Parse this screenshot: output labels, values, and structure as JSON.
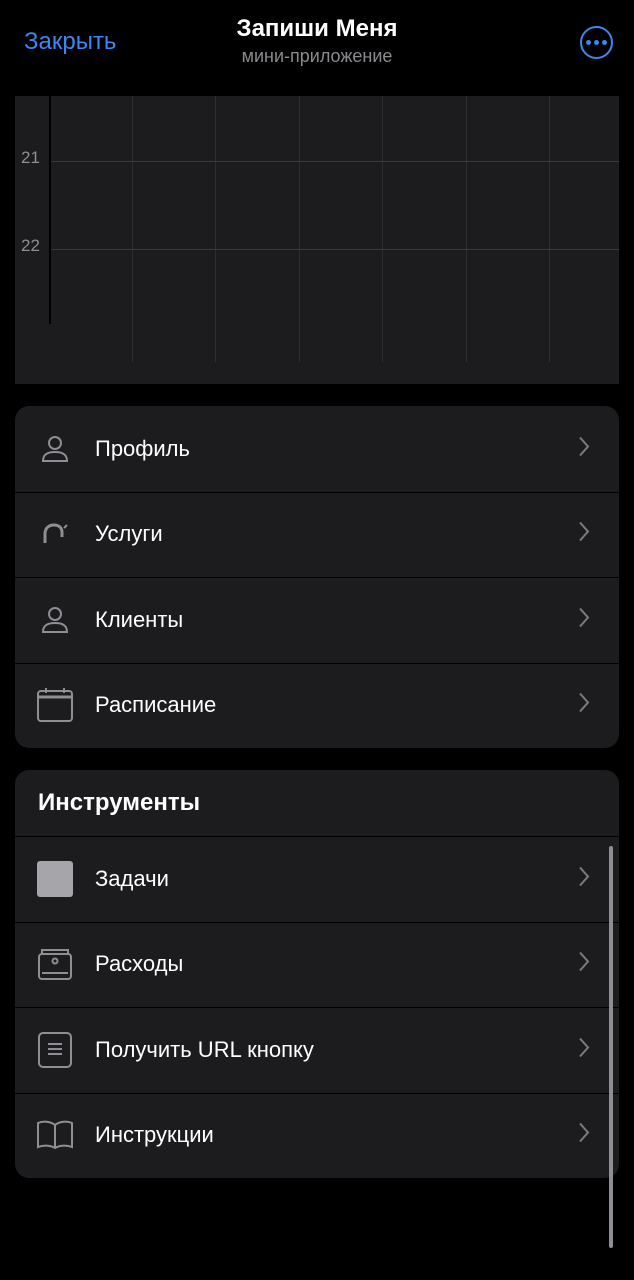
{
  "header": {
    "close_label": "Закрыть",
    "title": "Запиши Меня",
    "subtitle": "мини-приложение",
    "more_icon": "ellipsis-circle-icon"
  },
  "calendar": {
    "hours": [
      "21",
      "22"
    ]
  },
  "menu": {
    "items": [
      {
        "label": "Профиль",
        "icon": "person-icon"
      },
      {
        "label": "Услуги",
        "icon": "services-icon"
      },
      {
        "label": "Клиенты",
        "icon": "person-icon"
      },
      {
        "label": "Расписание",
        "icon": "calendar-icon"
      }
    ]
  },
  "tools": {
    "title": "Инструменты",
    "items": [
      {
        "label": "Задачи",
        "icon": "square-icon"
      },
      {
        "label": "Расходы",
        "icon": "wallet-icon"
      },
      {
        "label": "Получить URL кнопку",
        "icon": "document-icon"
      },
      {
        "label": "Инструкции",
        "icon": "book-icon"
      }
    ]
  },
  "colors": {
    "accent": "#3d86f5",
    "card_bg": "#1c1c1e",
    "background": "#000000"
  }
}
